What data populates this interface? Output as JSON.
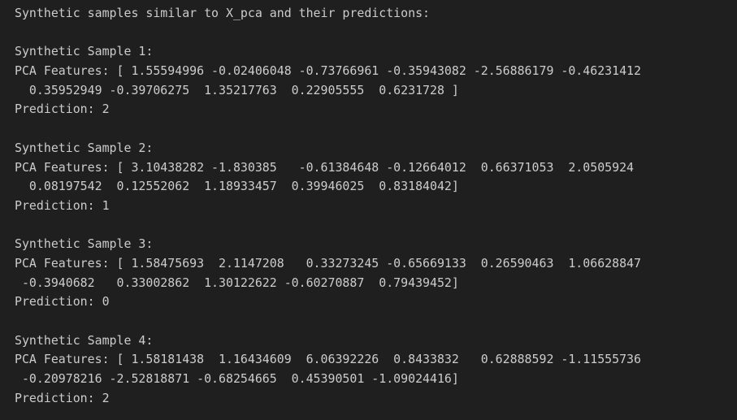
{
  "output": {
    "header": "Synthetic samples similar to X_pca and their predictions:",
    "samples": [
      {
        "title": "Synthetic Sample 1:",
        "features_line1": "PCA Features: [ 1.55594996 -0.02406048 -0.73766961 -0.35943082 -2.56886179 -0.46231412",
        "features_line2": "  0.35952949 -0.39706275  1.35217763  0.22905555  0.6231728 ]",
        "prediction": "Prediction: 2"
      },
      {
        "title": "Synthetic Sample 2:",
        "features_line1": "PCA Features: [ 3.10438282 -1.830385   -0.61384648 -0.12664012  0.66371053  2.0505924",
        "features_line2": "  0.08197542  0.12552062  1.18933457  0.39946025  0.83184042]",
        "prediction": "Prediction: 1"
      },
      {
        "title": "Synthetic Sample 3:",
        "features_line1": "PCA Features: [ 1.58475693  2.1147208   0.33273245 -0.65669133  0.26590463  1.06628847",
        "features_line2": " -0.3940682   0.33002862  1.30122622 -0.60270887  0.79439452]",
        "prediction": "Prediction: 0"
      },
      {
        "title": "Synthetic Sample 4:",
        "features_line1": "PCA Features: [ 1.58181438  1.16434609  6.06392226  0.8433832   0.62888592 -1.11555736",
        "features_line2": " -0.20978216 -2.52818871 -0.68254665  0.45390501 -1.09024416]",
        "prediction": "Prediction: 2"
      }
    ]
  },
  "colors": {
    "background": "#1f1f1f",
    "text": "#cccccc"
  }
}
